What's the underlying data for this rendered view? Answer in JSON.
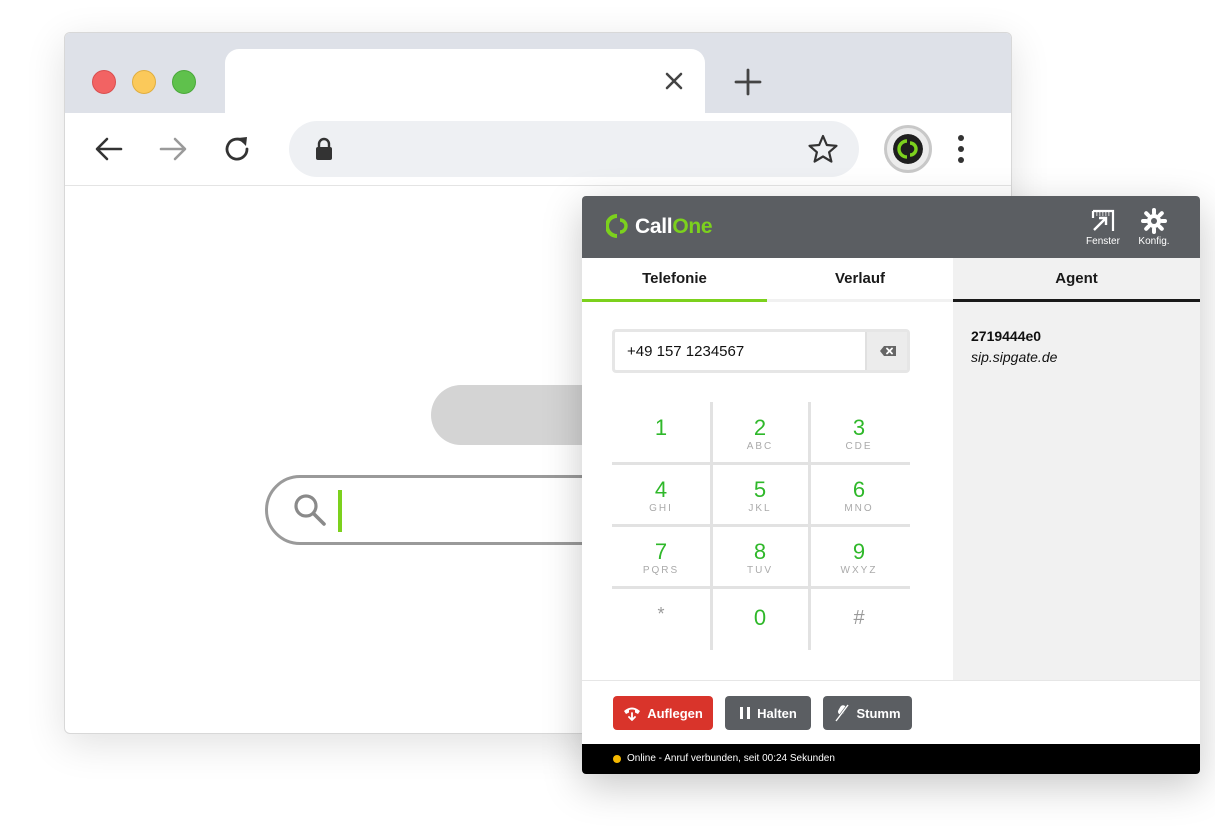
{
  "browser": {
    "tab": {
      "close_icon": "close-icon"
    },
    "new_tab_icon": "plus-icon",
    "omnibox": {
      "url": ""
    }
  },
  "callone": {
    "brand": {
      "part1": "Call",
      "part2": "One",
      "accent": "#7cd11d"
    },
    "header_buttons": [
      {
        "label": "Fenster",
        "icon": "popout-icon"
      },
      {
        "label": "Konfig.",
        "icon": "gear-icon"
      }
    ],
    "tabs": [
      {
        "label": "Telefonie",
        "active": true
      },
      {
        "label": "Verlauf",
        "active": false
      },
      {
        "label": "Agent",
        "active": false
      }
    ],
    "agent": {
      "id": "2719444e0",
      "host": "sip.sipgate.de"
    },
    "number": "+49 157 1234567",
    "keypad": [
      {
        "digit": "1",
        "letters": ""
      },
      {
        "digit": "2",
        "letters": "ABC"
      },
      {
        "digit": "3",
        "letters": "CDE"
      },
      {
        "digit": "4",
        "letters": "GHI"
      },
      {
        "digit": "5",
        "letters": "JKL"
      },
      {
        "digit": "6",
        "letters": "MNO"
      },
      {
        "digit": "7",
        "letters": "PQRS"
      },
      {
        "digit": "8",
        "letters": "TUV"
      },
      {
        "digit": "9",
        "letters": "WXYZ"
      },
      {
        "digit": "*",
        "letters": ""
      },
      {
        "digit": "0",
        "letters": ""
      },
      {
        "digit": "#",
        "letters": ""
      }
    ],
    "actions": {
      "hangup": "Auflegen",
      "hold": "Halten",
      "mute": "Stumm"
    },
    "colors": {
      "hangup": "#d9342b",
      "neutral": "#5b5e62",
      "status_dot": "#f5b800"
    },
    "status": "Online - Anruf verbunden, seit 00:24 Sekunden"
  }
}
